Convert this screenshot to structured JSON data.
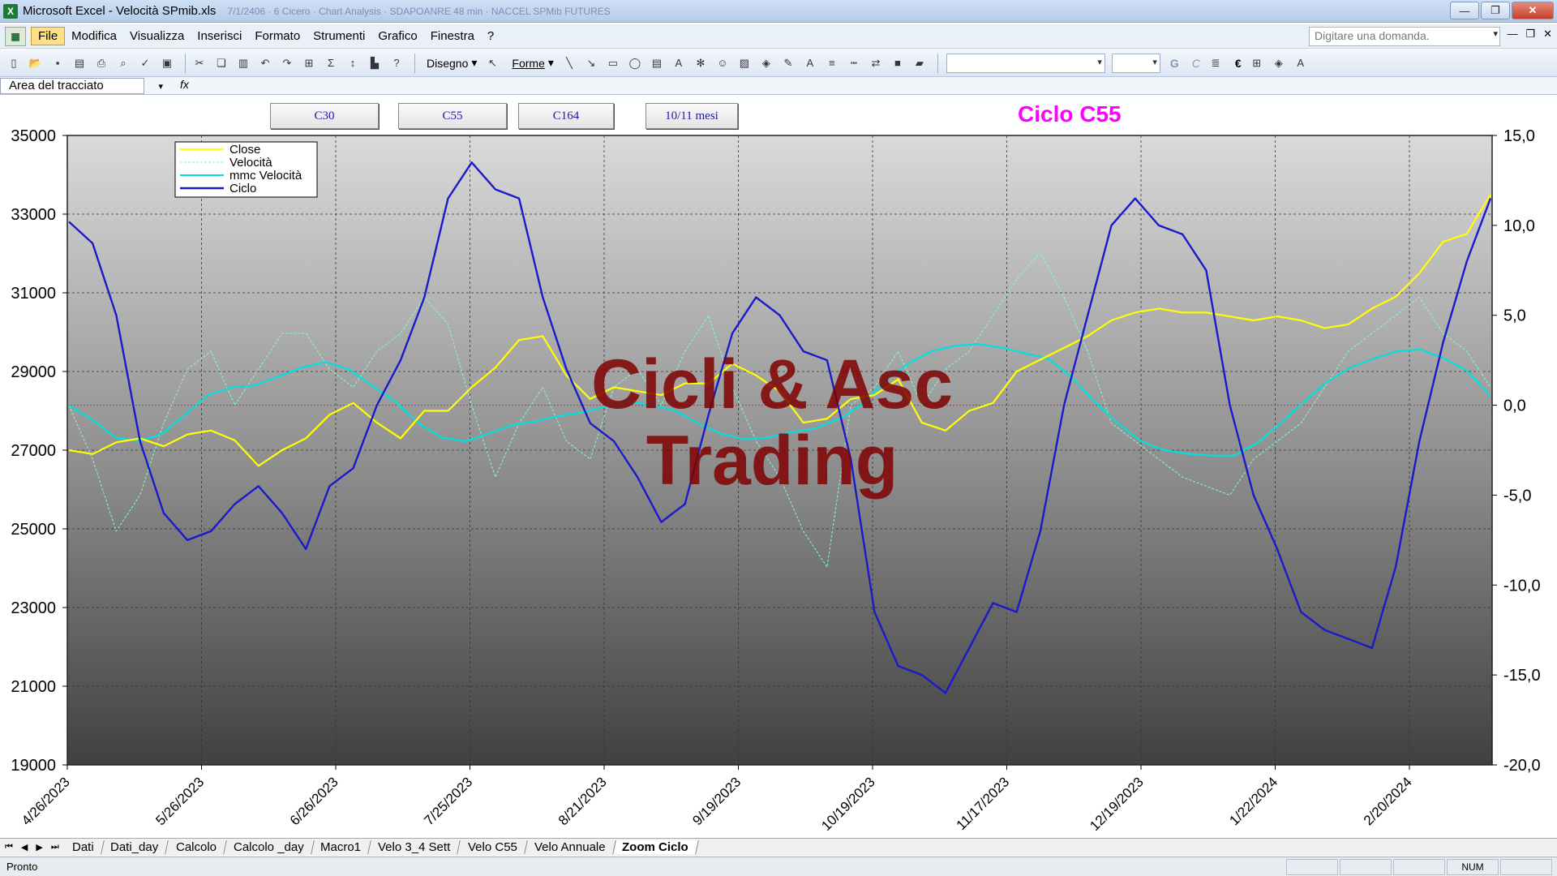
{
  "window": {
    "app_icon": "excel-icon",
    "title": "Microsoft Excel - Velocità SPmib.xls",
    "ghost_text": "7/1/2406 · 6 Cicero · Chart Analysis · SDAPOANRE 48 min · NACCEL SPMib FUTURES",
    "controls": [
      "minimize-icon",
      "restore-icon",
      "close-icon"
    ]
  },
  "menu": {
    "items": [
      "File",
      "Modifica",
      "Visualizza",
      "Inserisci",
      "Formato",
      "Strumenti",
      "Grafico",
      "Finestra",
      "?"
    ],
    "active": "File",
    "question_placeholder": "Digitare una domanda."
  },
  "toolbar": {
    "disegno_label": "Disegno",
    "forme_label": "Forme",
    "bold_label": "G",
    "italic_label": "C",
    "euro_label": "€"
  },
  "namebox": {
    "value": "Area del tracciato",
    "fx": "fx"
  },
  "buttons": [
    "C30",
    "C55",
    "C164",
    "10/11 mesi"
  ],
  "chart_heading": "Ciclo C55",
  "watermark": [
    "Cicli & Asc",
    "Trading"
  ],
  "chart_data": {
    "type": "line",
    "legend": {
      "placement": "top-left",
      "entries": [
        {
          "name": "Close",
          "color": "#ffff00"
        },
        {
          "name": "Velocità",
          "color": "#7fffd4"
        },
        {
          "name": "mmc Velocità",
          "color": "#00e0e0"
        },
        {
          "name": "Ciclo",
          "color": "#1a1acc"
        }
      ]
    },
    "y_left": {
      "min": 19000,
      "max": 35000,
      "ticks": [
        "35000",
        "33000",
        "31000",
        "29000",
        "27000",
        "25000",
        "23000",
        "21000",
        "19000"
      ]
    },
    "y_right": {
      "min": -20,
      "max": 15,
      "ticks": [
        "15,0",
        "10,0",
        "5,0",
        "0,0",
        "-5,0",
        "-10,0",
        "-15,0",
        "-20,0"
      ]
    },
    "x_labels": [
      "4/26/2023",
      "5/26/2023",
      "6/26/2023",
      "7/25/2023",
      "8/21/2023",
      "9/19/2023",
      "10/19/2023",
      "11/17/2023",
      "12/19/2023",
      "1/22/2024",
      "2/20/2024"
    ],
    "zero_line": 0,
    "series": [
      {
        "name": "Close",
        "axis": "left",
        "color": "#ffff00",
        "values": [
          27000,
          26900,
          27200,
          27300,
          27100,
          27400,
          27500,
          27250,
          26600,
          27000,
          27300,
          27900,
          28200,
          27700,
          27300,
          28000,
          28000,
          28600,
          29100,
          29800,
          29900,
          28900,
          28300,
          28600,
          28500,
          28400,
          28700,
          28700,
          29200,
          28900,
          28500,
          27700,
          27800,
          28300,
          28400,
          28800,
          27700,
          27500,
          28000,
          28200,
          29000,
          29300,
          29600,
          29900,
          30300,
          30500,
          30600,
          30500,
          30500,
          30400,
          30300,
          30400,
          30300,
          30100,
          30200,
          30600,
          30900,
          31500,
          32300,
          32500,
          33500
        ]
      },
      {
        "name": "Velocità",
        "axis": "right",
        "color": "#7fffd4",
        "values": [
          0.0,
          -3.0,
          -7.0,
          -5.0,
          -1.0,
          2.0,
          3.0,
          0.0,
          2.0,
          4.0,
          4.0,
          2.0,
          1.0,
          3.0,
          4.0,
          6.0,
          4.5,
          0.0,
          -4.0,
          -1.0,
          1.0,
          -2.0,
          -3.0,
          1.0,
          2.0,
          0.0,
          3.0,
          5.0,
          1.0,
          -2.0,
          -4.0,
          -7.0,
          -9.0,
          0.0,
          1.0,
          3.0,
          0.0,
          2.0,
          3.0,
          5.0,
          7.0,
          8.5,
          6.0,
          3.0,
          -1.0,
          -2.0,
          -3.0,
          -4.0,
          -4.5,
          -5.0,
          -3.0,
          -2.0,
          -1.0,
          1.0,
          3.0,
          4.0,
          5.0,
          6.0,
          4.0,
          3.0,
          1.0
        ]
      },
      {
        "name": "mmc Velocità",
        "axis": "right",
        "color": "#00e0e0",
        "values": [
          0.0,
          -0.8,
          -1.8,
          -2.0,
          -1.6,
          -0.5,
          0.6,
          1.0,
          1.1,
          1.6,
          2.1,
          2.4,
          2.0,
          1.1,
          0.2,
          -1.0,
          -1.8,
          -2.0,
          -1.6,
          -1.1,
          -0.9,
          -0.6,
          -0.4,
          -0.1,
          0.2,
          0.0,
          -0.3,
          -1.0,
          -1.6,
          -1.9,
          -1.8,
          -1.5,
          -1.3,
          -0.8,
          0.0,
          1.3,
          2.3,
          3.0,
          3.3,
          3.4,
          3.2,
          2.9,
          2.6,
          1.6,
          0.2,
          -1.0,
          -2.0,
          -2.5,
          -2.7,
          -2.8,
          -2.8,
          -2.1,
          -1.0,
          0.2,
          1.3,
          2.1,
          2.6,
          3.0,
          3.1,
          2.6,
          1.9,
          0.5
        ]
      },
      {
        "name": "Ciclo",
        "axis": "right",
        "color": "#1a1acc",
        "values": [
          10.2,
          9.0,
          5.0,
          -2.0,
          -6.0,
          -7.5,
          -7.0,
          -5.5,
          -4.5,
          -6.0,
          -8.0,
          -4.5,
          -3.5,
          0.0,
          2.5,
          6.0,
          11.5,
          13.5,
          12.0,
          11.5,
          6.0,
          2.0,
          -1.0,
          -2.0,
          -4.0,
          -6.5,
          -5.5,
          -0.5,
          4.0,
          6.0,
          5.0,
          3.0,
          2.5,
          -3.0,
          -11.5,
          -14.5,
          -15.0,
          -16.0,
          -13.5,
          -11.0,
          -11.5,
          -7.0,
          0.0,
          5.0,
          10.0,
          11.5,
          10.0,
          9.5,
          7.5,
          0.0,
          -5.0,
          -8.0,
          -11.5,
          -12.5,
          -13.0,
          -13.5,
          -9.0,
          -2.0,
          3.5,
          8.0,
          11.5
        ]
      }
    ]
  },
  "sheet_tabs": [
    "Dati",
    "Dati_day",
    "Calcolo",
    "Calcolo _day",
    "Macro1",
    "Velo 3_4 Sett",
    "Velo C55",
    "Velo Annuale",
    "Zoom Ciclo"
  ],
  "active_tab": "Zoom Ciclo",
  "status": {
    "left": "Pronto",
    "num": "NUM"
  }
}
